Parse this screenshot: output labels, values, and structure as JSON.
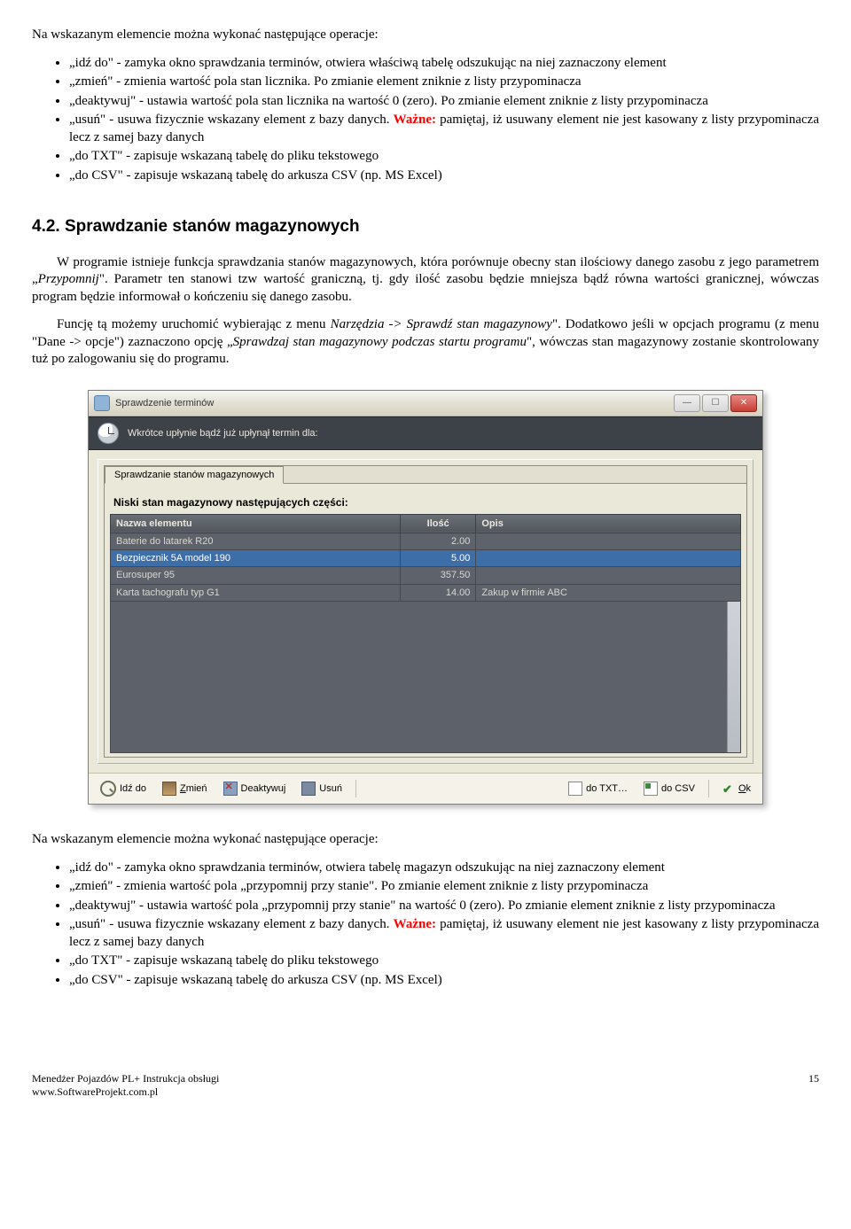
{
  "intro1": "Na wskazanym elemencie można wykonać następujące operacje:",
  "list1": {
    "i0": "„idź do\" - zamyka okno sprawdzania terminów, otwiera właściwą tabelę odszukując na niej zaznaczony element",
    "i1": "„zmień\" - zmienia wartość pola stan licznika. Po zmianie element zniknie z listy przypominacza",
    "i2": "„deaktywuj\" - ustawia wartość pola stan licznika na wartość 0 (zero). Po zmianie element zniknie z listy przypominacza",
    "i3a": "„usuń\" - usuwa fizycznie wskazany element z bazy danych. ",
    "i3warn": "Ważne:",
    "i3b": " pamiętaj, iż usuwany element nie jest kasowany z listy przypominacza lecz z samej bazy danych",
    "i4": "„do TXT\" - zapisuje wskazaną tabelę do pliku tekstowego",
    "i5": "„do CSV\" - zapisuje wskazaną tabelę do arkusza CSV (np. MS Excel)"
  },
  "section_heading": "4.2.  Sprawdzanie stanów magazynowych",
  "p1a": "W programie istnieje funkcja sprawdzania stanów magazynowych, która porównuje obecny stan ilościowy danego zasobu z jego parametrem „",
  "p1i": "Przypomnij",
  "p1b": "\". Parametr ten stanowi tzw wartość graniczną, tj. gdy ilość zasobu będzie mniejsza bądź równa wartości granicznej, wówczas program będzie informował o kończeniu się danego zasobu.",
  "p2a": "Funcję tą możemy uruchomić wybierając z menu ",
  "p2i1": "Narzędzia -> Sprawdź stan magazynowy",
  "p2b": "\". Dodatkowo jeśli w opcjach programu (z menu \"Dane -> opcje\") zaznaczono opcję „",
  "p2i2": "Sprawdzaj stan magazynowy podczas startu programu",
  "p2c": "\", wówczas stan magazynowy zostanie skontrolowany tuż po zalogowaniu się do programu.",
  "win": {
    "title": "Sprawdzenie terminów",
    "soon": "Wkrótce upłynie bądź już upłynął termin dla:",
    "tab": "Sprawdzanie stanów magazynowych",
    "grid_caption": "Niski stan magazynowy następujących części:",
    "cols": {
      "name": "Nazwa elementu",
      "qty": "Ilość",
      "desc": "Opis"
    },
    "rows": [
      {
        "name": "Baterie do latarek R20",
        "qty": "2.00",
        "desc": ""
      },
      {
        "name": "Bezpiecznik 5A model 190",
        "qty": "5.00",
        "desc": ""
      },
      {
        "name": "Eurosuper 95",
        "qty": "357.50",
        "desc": ""
      },
      {
        "name": "Karta tachografu typ G1",
        "qty": "14.00",
        "desc": "Zakup w firmie ABC"
      }
    ],
    "btns": {
      "go": "Idź do",
      "edit": "Zmień",
      "deact": "Deaktywuj",
      "del": "Usuń",
      "txt": "do TXT…",
      "csv": "do CSV",
      "ok": "Ok"
    }
  },
  "intro2": "Na wskazanym elemencie można wykonać następujące operacje:",
  "list2": {
    "i0": "„idź do\" - zamyka okno sprawdzania terminów, otwiera tabelę magazyn odszukując na niej zaznaczony element",
    "i1": "„zmień\" - zmienia wartość pola „przypomnij przy stanie\". Po zmianie element zniknie z listy przypominacza",
    "i2": "„deaktywuj\" - ustawia wartość pola „przypomnij przy stanie\" na wartość 0 (zero). Po zmianie element zniknie z listy przypominacza",
    "i3a": "„usuń\" - usuwa fizycznie wskazany element z bazy danych. ",
    "i3warn": "Ważne:",
    "i3b": " pamiętaj, iż usuwany element nie jest kasowany z listy przypominacza lecz z samej bazy danych",
    "i4": "„do TXT\" - zapisuje wskazaną tabelę do pliku tekstowego",
    "i5": "„do CSV\" - zapisuje wskazaną tabelę do arkusza CSV (np. MS Excel)"
  },
  "footer": {
    "line1": "Menedżer Pojazdów PL+ Instrukcja obsługi",
    "line2": "www.SoftwareProjekt.com.pl",
    "page": "15"
  }
}
